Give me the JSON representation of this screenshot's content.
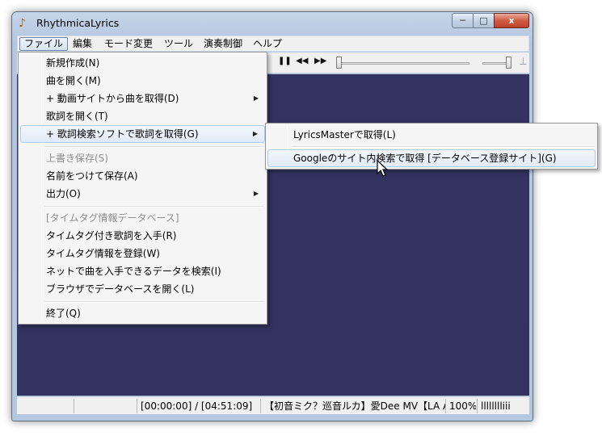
{
  "window": {
    "title": "RhythmicaLyrics"
  },
  "titlebar": {
    "minimize": "─",
    "maximize": "□",
    "close": "x"
  },
  "menubar": [
    "ファイル",
    "編集",
    "モード変更",
    "ツール",
    "演奏制御",
    "ヘルプ"
  ],
  "toolbar": {
    "pause": "❚❚",
    "rewind": "◀◀",
    "forward": "▶▶",
    "pin": "⟂"
  },
  "file_menu": {
    "items": [
      "新規作成(N)",
      "曲を開く(M)",
      "+ 動画サイトから曲を取得(D)",
      "歌詞を開く(T)",
      "+ 歌詞検索ソフトで歌詞を取得(G)",
      "上書き保存(S)",
      "名前をつけて保存(A)",
      "出力(O)",
      "[タイムタグ情報データベース]",
      "タイムタグ付き歌詞を入手(R)",
      "タイムタグ情報を登録(W)",
      "ネットで曲を入手できるデータを検索(I)",
      "ブラウザでデータベースを開く(L)",
      "終了(Q)"
    ]
  },
  "submenu": {
    "items": [
      "LyricsMasterで取得(L)",
      "Googleのサイト内検索で取得 [データベース登録サイト](G)"
    ]
  },
  "status": {
    "time": "[00:00:00] / [04:51:09]",
    "track": "【初音ミク？巡音ルカ】愛Dee MV【LA A",
    "zoom": "100%",
    "level": "lllllllliii"
  },
  "playback": {
    "seek_position": 0.0,
    "volume": 1.0
  }
}
